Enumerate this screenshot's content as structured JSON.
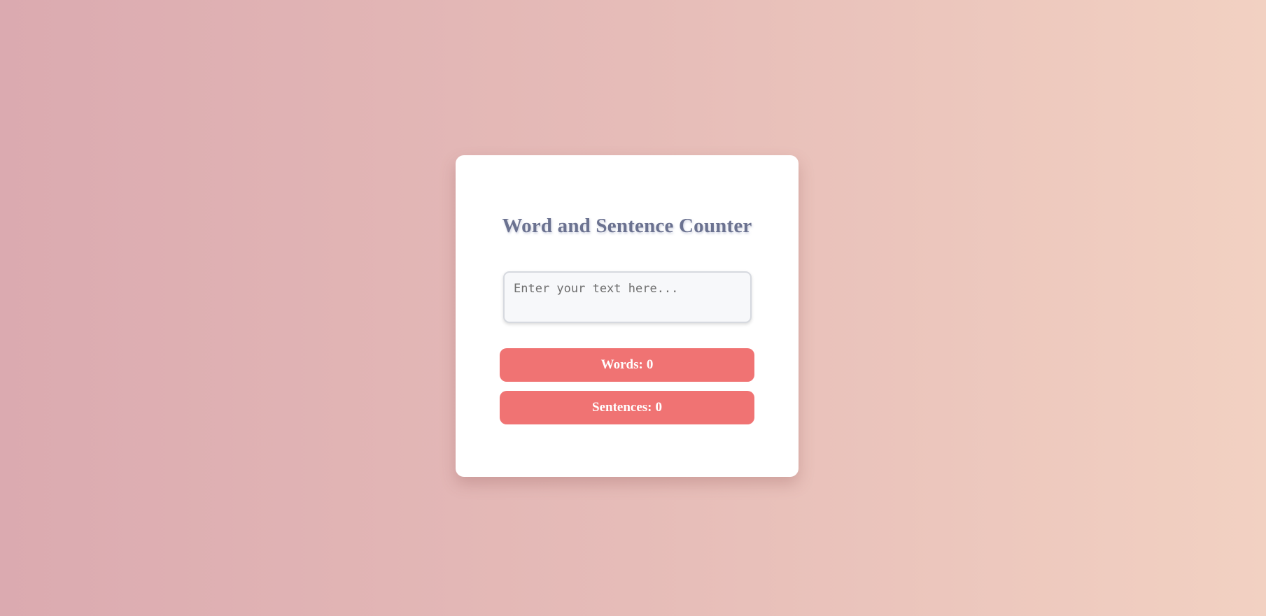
{
  "app": {
    "title": "Word and Sentence Counter"
  },
  "input": {
    "placeholder": "Enter your text here...",
    "value": ""
  },
  "stats": {
    "words_label": "Words:",
    "words_count": "0",
    "sentences_label": "Sentences:",
    "sentences_count": "0"
  },
  "colors": {
    "background_start": "#dbaab0",
    "background_end": "#f2d1c2",
    "card": "#ffffff",
    "title": "#6b7290",
    "stat_badge": "#f07373",
    "stat_text": "#ffffff"
  }
}
